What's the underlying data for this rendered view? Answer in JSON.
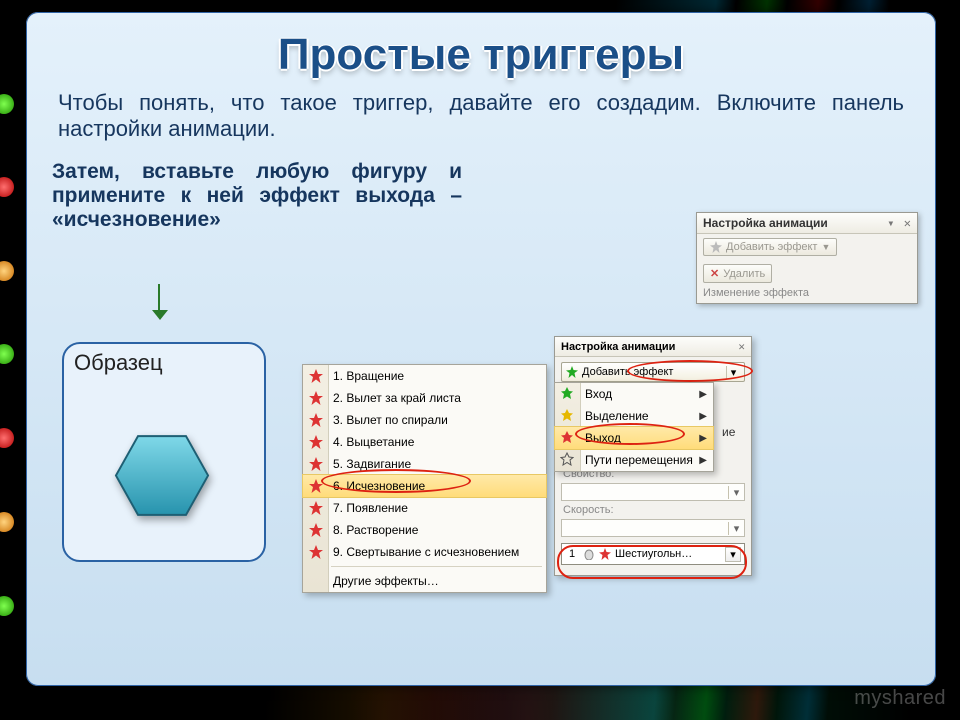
{
  "title": "Простые триггеры",
  "paragraph1": "Чтобы понять, что такое триггер, давайте его создадим.  Включите панель настройки анимации.",
  "paragraph2": "Затем, вставьте любую фигуру и примените к ней эффект выхода – «исчезновение»",
  "sample_label": "Образец",
  "panelA": {
    "title": "Настройка анимации",
    "close": "✕",
    "pin": "▾",
    "add_effect": "Добавить эффект",
    "delete": "Удалить",
    "caption": "Изменение эффекта"
  },
  "effects": {
    "items": [
      "1. Вращение",
      "2. Вылет за край листа",
      "3. Вылет по спирали",
      "4. Выцветание",
      "5. Задвигание",
      "6. Исчезновение",
      "7. Появление",
      "8. Растворение",
      "9. Свертывание с исчезновением"
    ],
    "more": "Другие эффекты…"
  },
  "submenu": {
    "items": [
      "Вход",
      "Выделение",
      "Выход",
      "Пути перемещения"
    ],
    "cutoff_label": "ие"
  },
  "panelB": {
    "title": "Настройка анимации",
    "add_effect": "Добавить эффект",
    "property": "Свойство:",
    "speed": "Скорость:",
    "anim_index": "1",
    "anim_name": "Шестиугольн…"
  },
  "watermark": "myshared"
}
